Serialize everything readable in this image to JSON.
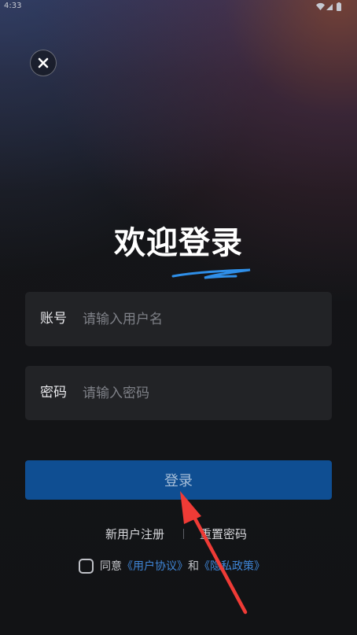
{
  "status_bar": {
    "time": "4:33",
    "icons": [
      "wifi-icon",
      "signal-icon",
      "battery-icon"
    ]
  },
  "close": {
    "icon": "close-icon"
  },
  "title": "欢迎登录",
  "account": {
    "label": "账号",
    "placeholder": "请输入用户名",
    "value": ""
  },
  "password": {
    "label": "密码",
    "placeholder": "请输入密码",
    "value": ""
  },
  "login_button": "登录",
  "links": {
    "register": "新用户注册",
    "reset": "重置密码"
  },
  "agreement": {
    "checked": false,
    "prefix": "同意",
    "user_agreement": "《用户协议》",
    "and": "和",
    "privacy_policy": "《隐私政策》"
  },
  "colors": {
    "background": "#121315",
    "field_background": "#222326",
    "primary_button": "#0f4e92",
    "link": "#3f86d8",
    "annotation_arrow": "#ef3b36",
    "swoosh": "#2f8fe8"
  }
}
